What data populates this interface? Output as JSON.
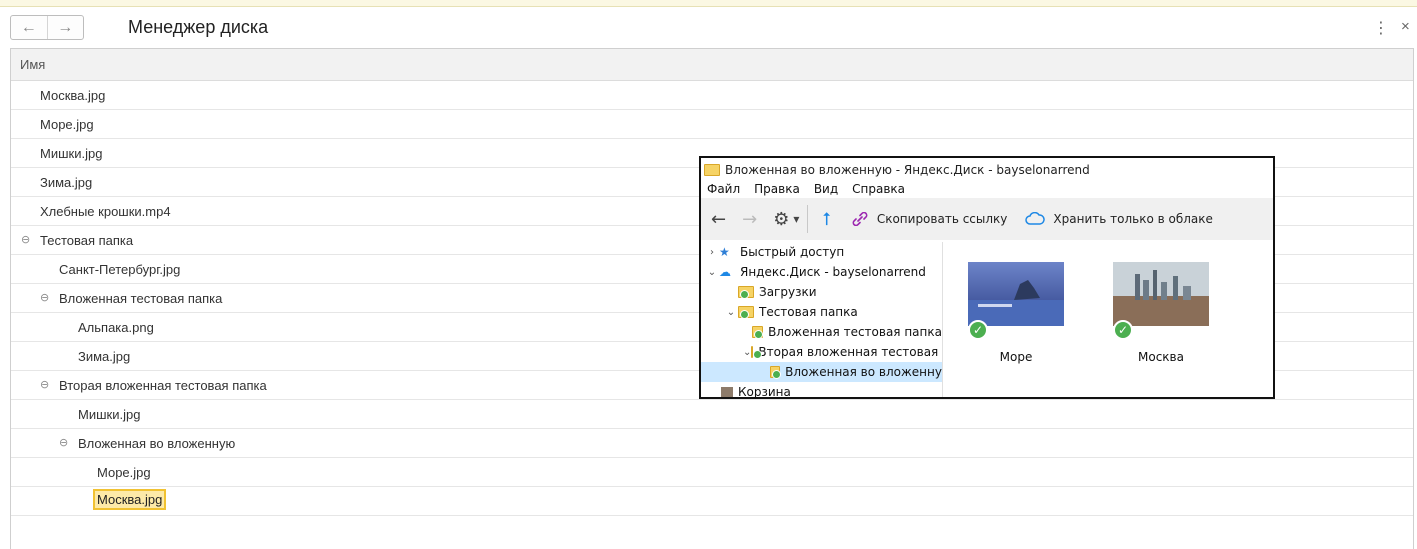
{
  "header": {
    "title": "Менеджер диска",
    "back_icon": "←",
    "forward_icon": "→",
    "more_icon": "⋮",
    "close_icon": "×"
  },
  "grid": {
    "column_header": "Имя",
    "rows": [
      {
        "label": "Москва.jpg",
        "level": 0,
        "expander": ""
      },
      {
        "label": "Море.jpg",
        "level": 0,
        "expander": ""
      },
      {
        "label": "Мишки.jpg",
        "level": 0,
        "expander": ""
      },
      {
        "label": "Зима.jpg",
        "level": 0,
        "expander": ""
      },
      {
        "label": "Хлебные крошки.mp4",
        "level": 0,
        "expander": ""
      },
      {
        "label": "Тестовая папка",
        "level": 0,
        "expander": "⊖"
      },
      {
        "label": "Санкт-Петербург.jpg",
        "level": 1,
        "expander": ""
      },
      {
        "label": "Вложенная тестовая папка",
        "level": 1,
        "expander": "⊖"
      },
      {
        "label": "Альпака.png",
        "level": 2,
        "expander": ""
      },
      {
        "label": "Зима.jpg",
        "level": 2,
        "expander": ""
      },
      {
        "label": "Вторая вложенная тестовая папка",
        "level": 1,
        "expander": "⊖"
      },
      {
        "label": "Мишки.jpg",
        "level": 2,
        "expander": ""
      },
      {
        "label": "Вложенная во вложенную",
        "level": 2,
        "expander": "⊖"
      },
      {
        "label": "Море.jpg",
        "level": 3,
        "expander": ""
      },
      {
        "label": "Москва.jpg",
        "level": 3,
        "expander": "",
        "selected": true
      }
    ]
  },
  "explorer": {
    "window_title": "Вложенная во вложенную - Яндекс.Диск - bayselonarrend",
    "menu": [
      "Файл",
      "Правка",
      "Вид",
      "Справка"
    ],
    "toolbar": {
      "back": "←",
      "forward": "→",
      "settings": "⚙",
      "dropdown": "▾",
      "upload": "⭡",
      "copy_link": "Скопировать ссылку",
      "cloud_only": "Хранить только в облаке"
    },
    "tree": [
      {
        "label": "Быстрый доступ",
        "chevron": "›",
        "icon": "star-icon",
        "indent": 0
      },
      {
        "label": "Яндекс.Диск - bayselonarrend",
        "chevron": "⌄",
        "icon": "cloud-icon",
        "indent": 0
      },
      {
        "label": "Загрузки",
        "chevron": "",
        "icon": "folder-icon",
        "indent": 1
      },
      {
        "label": "Тестовая папка",
        "chevron": "⌄",
        "icon": "folder-icon",
        "indent": 1
      },
      {
        "label": "Вложенная тестовая папка",
        "chevron": "",
        "icon": "folder-icon",
        "indent": 2
      },
      {
        "label": "Вторая вложенная тестовая п",
        "chevron": "⌄",
        "icon": "folder-icon",
        "indent": 2
      },
      {
        "label": "Вложенная во вложенну",
        "chevron": "",
        "icon": "folder-icon",
        "indent": 3,
        "selected": true
      },
      {
        "label": "Корзина",
        "chevron": "",
        "icon": "trash-icon",
        "indent": 0
      }
    ],
    "files": [
      {
        "caption": "Море",
        "image": "sea-thumbnail"
      },
      {
        "caption": "Москва",
        "image": "moscow-thumbnail"
      }
    ]
  },
  "colors": {
    "selection_fill": "#fdeaa8",
    "selection_border": "#f1c232",
    "tree_selected": "#cce8ff",
    "sync_ok": "#4caf50"
  }
}
